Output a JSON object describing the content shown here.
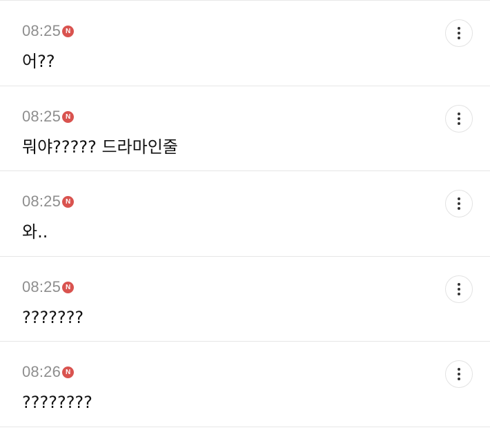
{
  "colors": {
    "timestamp": "#8e8e8e",
    "badge": "#d9534f",
    "divider": "#e6e6e6",
    "message_text": "#111111"
  },
  "comments": [
    {
      "time": "08:25",
      "badge": "N",
      "text": "어??",
      "menu_icon": "more-vertical-icon"
    },
    {
      "time": "08:25",
      "badge": "N",
      "text": "뭐야????? 드라마인줄",
      "menu_icon": "more-vertical-icon"
    },
    {
      "time": "08:25",
      "badge": "N",
      "text": "와..",
      "menu_icon": "more-vertical-icon"
    },
    {
      "time": "08:25",
      "badge": "N",
      "text": "???????",
      "menu_icon": "more-vertical-icon"
    },
    {
      "time": "08:26",
      "badge": "N",
      "text": "????????",
      "menu_icon": "more-vertical-icon"
    }
  ]
}
